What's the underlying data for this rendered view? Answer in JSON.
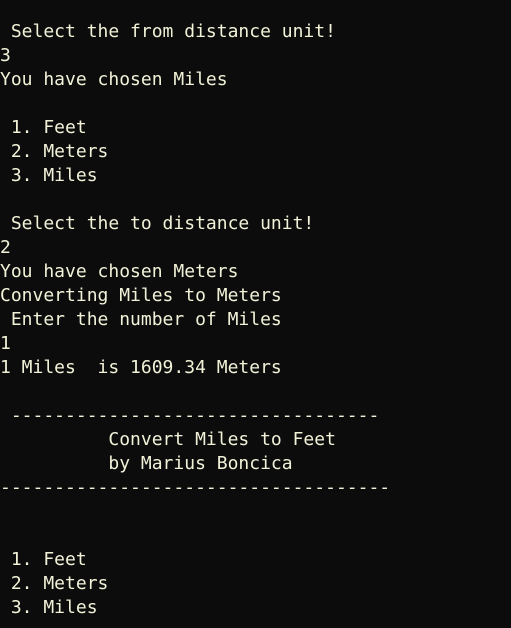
{
  "console": {
    "lines": [
      " Select the from distance unit!",
      "3",
      "You have chosen Miles",
      "",
      " 1. Feet",
      " 2. Meters",
      " 3. Miles",
      "",
      " Select the to distance unit!",
      "2",
      "You have chosen Meters",
      "Converting Miles to Meters",
      " Enter the number of Miles",
      "1",
      "1 Miles  is 1609.34 Meters",
      "",
      " ----------------------------------",
      "          Convert Miles to Feet",
      "          by Marius Boncica",
      "------------------------------------",
      "",
      "",
      " 1. Feet",
      " 2. Meters",
      " 3. Miles"
    ]
  }
}
